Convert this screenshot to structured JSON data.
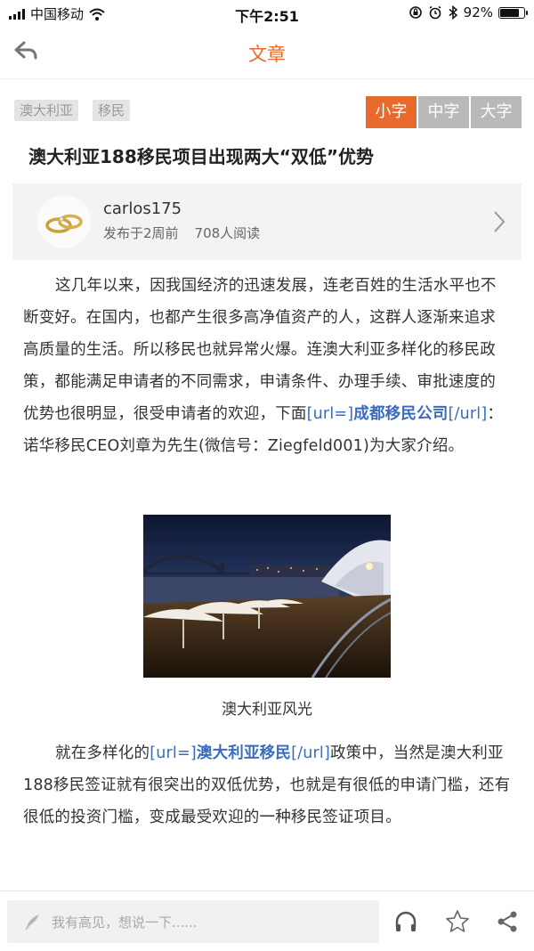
{
  "status": {
    "carrier": "中国移动",
    "time": "下午2:51",
    "battery_percent": "92%",
    "battery_level": 0.92
  },
  "nav": {
    "title": "文章"
  },
  "tags": [
    "澳大利亚",
    "移民"
  ],
  "font_size_options": [
    "小字",
    "中字",
    "大字"
  ],
  "font_size_selected": "小字",
  "article": {
    "title": "澳大利亚188移民项目出现两大“双低”优势",
    "author": "carlos175",
    "posted": "发布于2周前",
    "reads": "708人阅读",
    "para1_a": "这几年以来，因我国经济的迅速发展，连老百姓的生活水平也不断变好。在国内，也都产生很多高净值资产的人，这群人逐渐来追求高质量的生活。所以移民也就异常火爆。连澳大利亚多样化的移民政策，都能满足申请者的不同需求，申请条件、办理手续、审批速度的优势也很明显，很受申请者的欢迎，下面",
    "para1_link_open": "[url=]",
    "para1_link_text": "成都移民公司",
    "para1_link_close": "[/url]",
    "para1_b": "：诺华移民CEO刘章为先生(微信号：Ziegfeld001)为大家介绍。",
    "image_caption": "澳大利亚风光",
    "para2_a": "就在多样化的",
    "para2_link_open": "[url=]",
    "para2_link_text": "澳大利亚移民",
    "para2_link_close": "[/url]",
    "para2_b": "政策中，当然是澳大利亚188移民签证就有很突出的双低优势，也就是有很低的申请门槛，还有很低的投资门槛，变成最受欢迎的一种移民签证项目。"
  },
  "bottom": {
    "comment_placeholder": "我有高见，想说一下......"
  },
  "colors": {
    "accent": "#e8692c",
    "link": "#3b6bbf",
    "inactive_button": "#b9b9b9",
    "tag_bg": "#e4e4e4"
  },
  "icons": [
    "signal-icon",
    "wifi-icon",
    "orientation-lock-icon",
    "alarm-icon",
    "bluetooth-icon",
    "battery-icon",
    "back-arrow-icon",
    "chevron-right-icon",
    "pen-icon",
    "headphones-icon",
    "star-icon",
    "share-icon"
  ]
}
